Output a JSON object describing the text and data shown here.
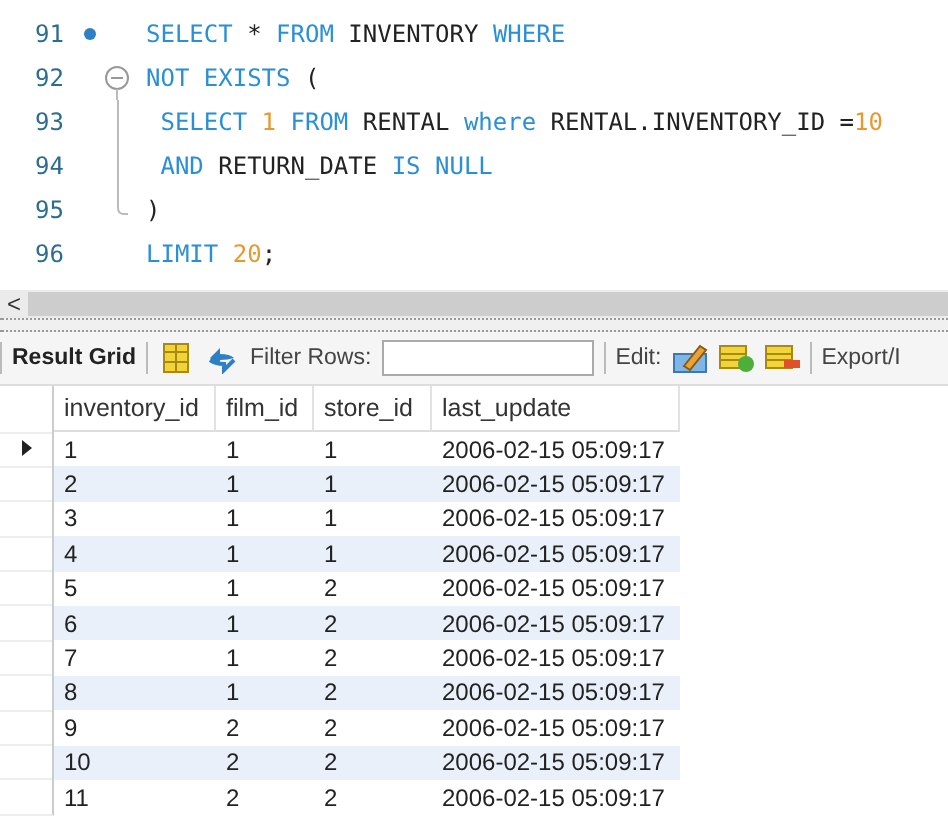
{
  "editor": {
    "lines": [
      {
        "number": "91",
        "breakpoint": true,
        "kind": "plain",
        "tokens": [
          {
            "kind": "keyword",
            "text": "SELECT"
          },
          {
            "kind": "plain",
            "text": " * "
          },
          {
            "kind": "keyword",
            "text": "FROM"
          },
          {
            "kind": "plain",
            "text": " INVENTORY "
          },
          {
            "kind": "keyword",
            "text": "WHERE"
          }
        ]
      },
      {
        "number": "92",
        "breakpoint": false,
        "kind": "fold-start",
        "tokens": [
          {
            "kind": "keyword",
            "text": "NOT EXISTS"
          },
          {
            "kind": "plain",
            "text": " ("
          }
        ]
      },
      {
        "number": "93",
        "breakpoint": false,
        "kind": "fold-body",
        "tokens": [
          {
            "kind": "keyword",
            "text": " SELECT"
          },
          {
            "kind": "number",
            "text": " 1"
          },
          {
            "kind": "keyword",
            "text": " FROM"
          },
          {
            "kind": "plain",
            "text": " RENTAL "
          },
          {
            "kind": "keyword",
            "text": "where"
          },
          {
            "kind": "plain",
            "text": " RENTAL.INVENTORY_ID ="
          },
          {
            "kind": "number",
            "text": "10"
          }
        ]
      },
      {
        "number": "94",
        "breakpoint": false,
        "kind": "fold-body",
        "tokens": [
          {
            "kind": "keyword",
            "text": " AND"
          },
          {
            "kind": "plain",
            "text": " RETURN_DATE "
          },
          {
            "kind": "keyword",
            "text": "IS NULL"
          }
        ]
      },
      {
        "number": "95",
        "breakpoint": false,
        "kind": "fold-end",
        "tokens": [
          {
            "kind": "plain",
            "text": ")"
          }
        ]
      },
      {
        "number": "96",
        "breakpoint": false,
        "kind": "plain",
        "tokens": [
          {
            "kind": "keyword",
            "text": "LIMIT"
          },
          {
            "kind": "number",
            "text": " 20"
          },
          {
            "kind": "plain",
            "text": ";"
          }
        ]
      }
    ],
    "scroll_arrow": "<"
  },
  "toolbar": {
    "title": "Result Grid",
    "filter_label": "Filter Rows:",
    "edit_label": "Edit:",
    "export_label": "Export/I"
  },
  "table": {
    "columns": [
      "inventory_id",
      "film_id",
      "store_id",
      "last_update"
    ],
    "rows": [
      {
        "current": true,
        "cells": [
          "1",
          "1",
          "1",
          "2006-02-15 05:09:17"
        ]
      },
      {
        "current": false,
        "cells": [
          "2",
          "1",
          "1",
          "2006-02-15 05:09:17"
        ]
      },
      {
        "current": false,
        "cells": [
          "3",
          "1",
          "1",
          "2006-02-15 05:09:17"
        ]
      },
      {
        "current": false,
        "cells": [
          "4",
          "1",
          "1",
          "2006-02-15 05:09:17"
        ]
      },
      {
        "current": false,
        "cells": [
          "5",
          "1",
          "2",
          "2006-02-15 05:09:17"
        ]
      },
      {
        "current": false,
        "cells": [
          "6",
          "1",
          "2",
          "2006-02-15 05:09:17"
        ]
      },
      {
        "current": false,
        "cells": [
          "7",
          "1",
          "2",
          "2006-02-15 05:09:17"
        ]
      },
      {
        "current": false,
        "cells": [
          "8",
          "1",
          "2",
          "2006-02-15 05:09:17"
        ]
      },
      {
        "current": false,
        "cells": [
          "9",
          "2",
          "2",
          "2006-02-15 05:09:17"
        ]
      },
      {
        "current": false,
        "cells": [
          "10",
          "2",
          "2",
          "2006-02-15 05:09:17"
        ]
      },
      {
        "current": false,
        "cells": [
          "11",
          "2",
          "2",
          "2006-02-15 05:09:17"
        ]
      }
    ]
  }
}
